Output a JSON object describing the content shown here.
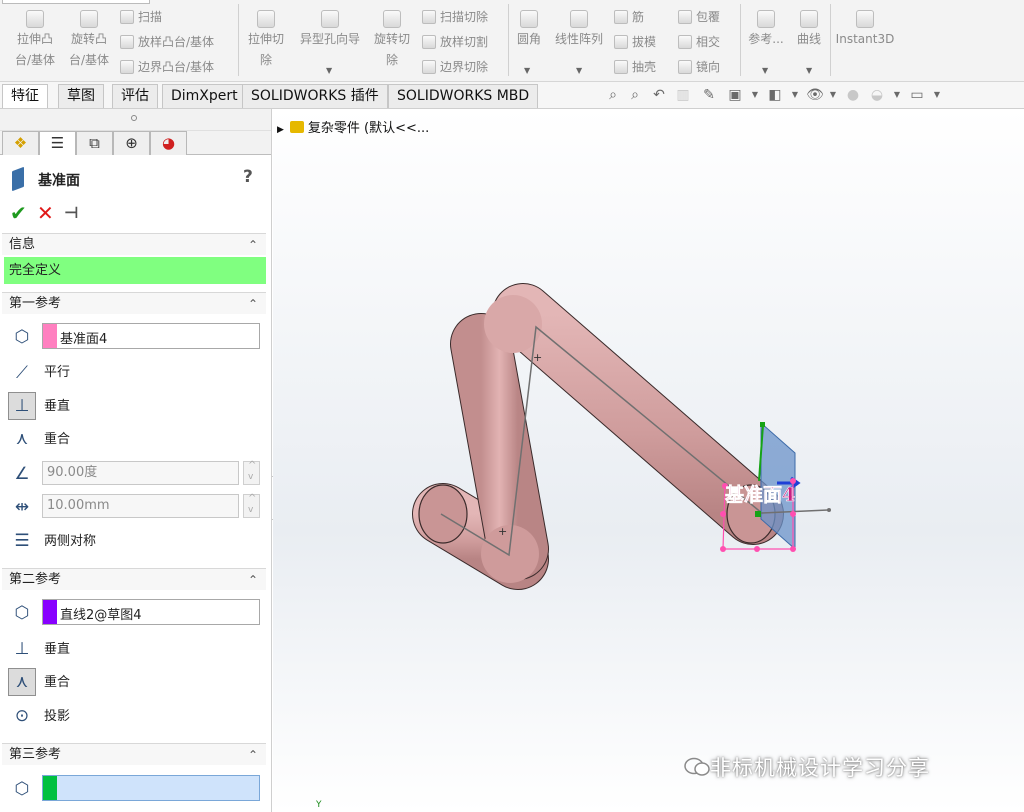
{
  "ribbon": {
    "extrude_boss": "拉伸凸台/基体",
    "revolve_boss": "旋转凸台/基体",
    "sweep": "扫描",
    "loft_boss": "放样凸台/基体",
    "boundary_boss": "边界凸台/基体",
    "extrude_cut": "拉伸切除",
    "hole_wizard": "异型孔向导",
    "revolve_cut": "旋转切除",
    "swept_cut": "扫描切除",
    "lofted_cut": "放样切割",
    "boundary_cut": "边界切除",
    "fillet": "圆角",
    "linear_pattern": "线性阵列",
    "rib": "筋",
    "draft": "拔模",
    "shell": "抽壳",
    "wrap": "包覆",
    "intersect": "相交",
    "mirror": "镜向",
    "reference": "参考...",
    "curves": "曲线",
    "instant3d": "Instant3D"
  },
  "tabs": [
    "特征",
    "草图",
    "评估",
    "DimXpert",
    "SOLIDWORKS 插件",
    "SOLIDWORKS MBD"
  ],
  "panel": {
    "title": "基准面",
    "help": "?",
    "info": {
      "header": "信息",
      "status": "完全定义"
    },
    "first_ref": {
      "header": "第一参考",
      "selection": "基准面4",
      "selection_color": "#ff80c0",
      "options": [
        "平行",
        "垂直",
        "重合"
      ],
      "angle": "90.00度",
      "distance": "10.00mm",
      "symmetric": "两侧对称"
    },
    "second_ref": {
      "header": "第二参考",
      "selection": "直线2@草图4",
      "selection_color": "#8800ff",
      "options": [
        "垂直",
        "重合",
        "投影"
      ]
    },
    "third_ref": {
      "header": "第三参考",
      "selection": "",
      "selection_color": "#00c040"
    }
  },
  "viewport": {
    "tree_label": "复杂零件 (默认<<...",
    "plane_label": "基准面4",
    "model_color": "#d6a3a3",
    "axis_label": "Y"
  },
  "watermark": "非标机械设计学习分享"
}
